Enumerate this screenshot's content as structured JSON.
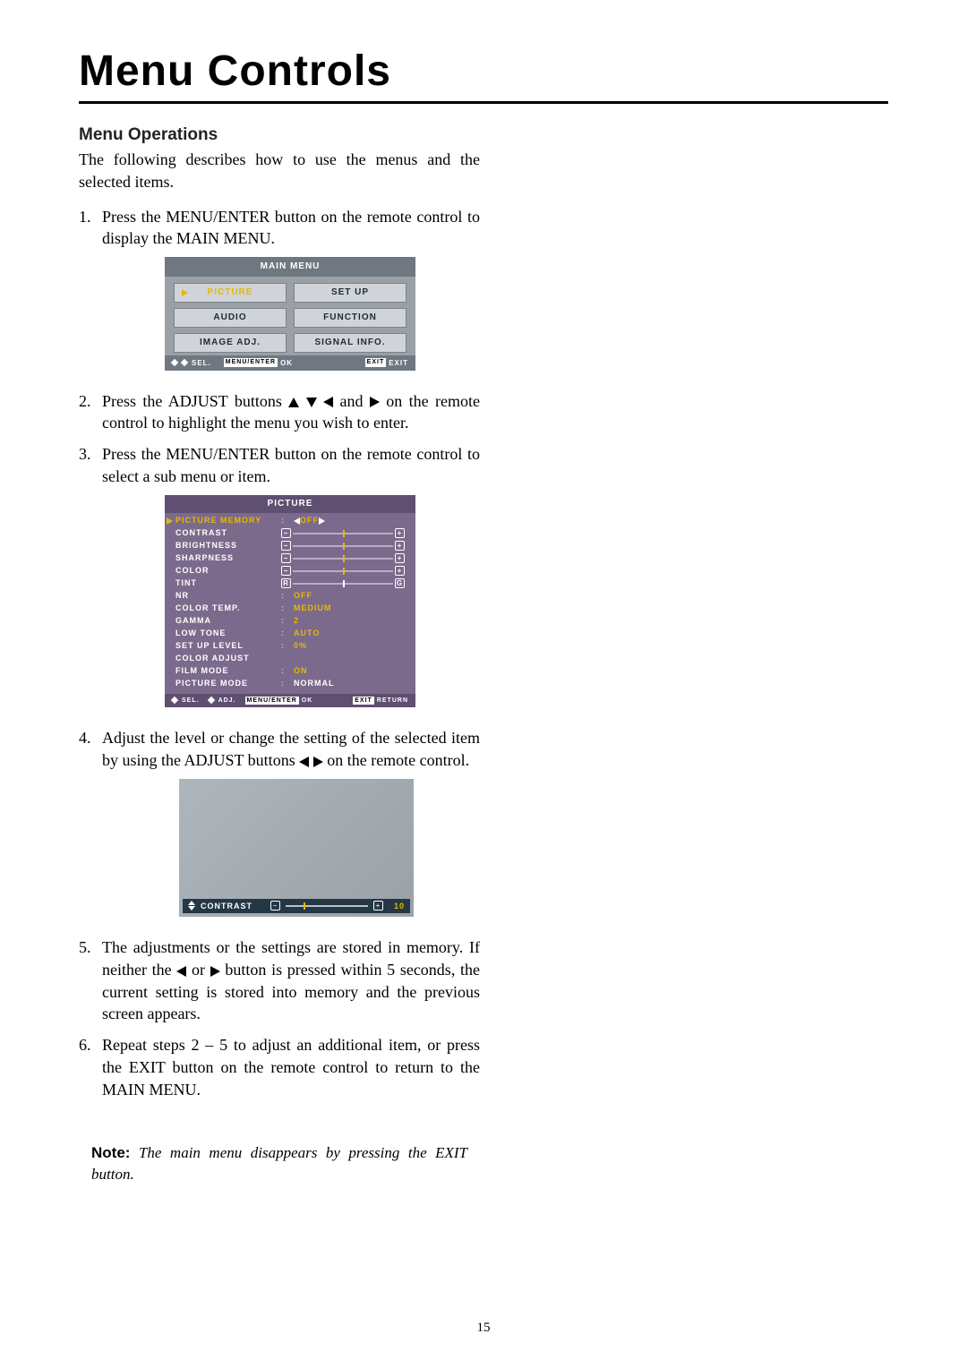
{
  "page": {
    "title": "Menu Controls",
    "section": "Menu Operations",
    "intro": "The following describes how to use the menus and the selected items.",
    "page_number": "15"
  },
  "steps": {
    "s1": "Press the MENU/ENTER button on the remote control to display the MAIN MENU.",
    "s2a": "Press the ADJUST buttons ",
    "s2b": " and ",
    "s2c": " on the remote control to highlight the menu you wish to enter.",
    "s3": "Press the MENU/ENTER button on the remote control to select a sub menu or item.",
    "s4a": "Adjust the level or change the setting of the selected item by using the ADJUST buttons ",
    "s4b": " on the remote control.",
    "s5a": "The adjustments or the settings are stored in memory. If neither the ",
    "s5b": " or ",
    "s5c": " button is pressed within 5 seconds, the current setting is stored into memory and the previous screen appears.",
    "s6": "Repeat steps 2 – 5 to adjust an additional item, or press the EXIT button on the remote control to return to the MAIN MENU."
  },
  "fig1": {
    "title": "MAIN MENU",
    "items": [
      "PICTURE",
      "SET UP",
      "AUDIO",
      "FUNCTION",
      "IMAGE ADJ.",
      "SIGNAL INFO."
    ],
    "foot_sel": "SEL.",
    "foot_ok_box": "MENU/ENTER",
    "foot_ok": "OK",
    "foot_exit_box": "EXIT",
    "foot_exit": "EXIT"
  },
  "fig2": {
    "title": "PICTURE",
    "rows": {
      "picture_memory": {
        "name": "PICTURE MEMORY",
        "value": "OFF"
      },
      "contrast": {
        "name": "CONTRAST"
      },
      "brightness": {
        "name": "BRIGHTNESS"
      },
      "sharpness": {
        "name": "SHARPNESS"
      },
      "color": {
        "name": "COLOR"
      },
      "tint": {
        "name": "TINT"
      },
      "nr": {
        "name": "NR",
        "value": "OFF"
      },
      "color_temp": {
        "name": "COLOR TEMP.",
        "value": "MEDIUM"
      },
      "gamma": {
        "name": "GAMMA",
        "value": "2"
      },
      "low_tone": {
        "name": "LOW TONE",
        "value": "AUTO"
      },
      "setup_level": {
        "name": "SET UP LEVEL",
        "value": "0%"
      },
      "color_adjust": {
        "name": "COLOR ADJUST"
      },
      "film_mode": {
        "name": "FILM MODE",
        "value": "ON"
      },
      "picture_mode": {
        "name": "PICTURE MODE",
        "value": "NORMAL"
      }
    },
    "foot_sel": "SEL.",
    "foot_adj": "ADJ.",
    "foot_ok_box": "MENU/ENTER",
    "foot_ok": "OK",
    "foot_ret_box": "EXIT",
    "foot_ret": "RETURN"
  },
  "fig3": {
    "label": "CONTRAST",
    "value": "10"
  },
  "note": {
    "label": "Note:",
    "body": " The main menu disappears by pressing the EXIT button."
  }
}
